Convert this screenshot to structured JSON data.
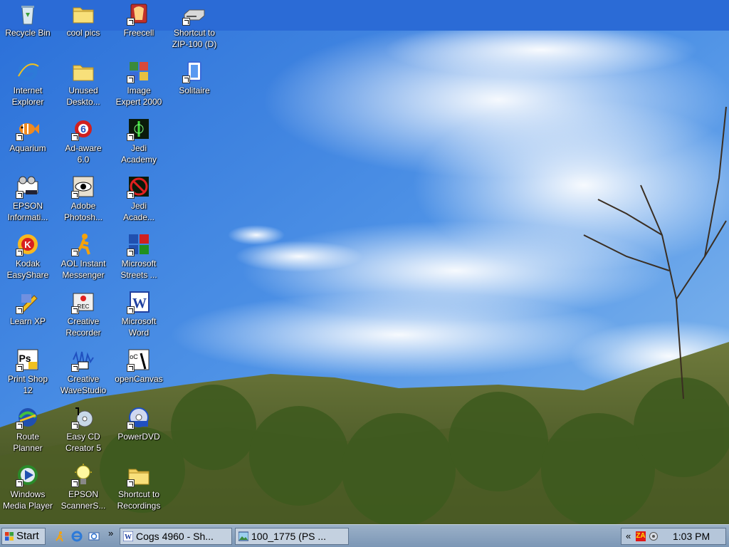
{
  "desktop": {
    "icons": [
      {
        "label": "Recycle Bin",
        "icon": "recycle-bin-icon"
      },
      {
        "label": "cool pics",
        "icon": "folder-icon"
      },
      {
        "label": "Freecell",
        "icon": "freecell-icon"
      },
      {
        "label": "Shortcut to\nZIP-100 (D)",
        "icon": "zip-drive-icon"
      },
      {
        "label": "Internet\nExplorer",
        "icon": "internet-explorer-icon"
      },
      {
        "label": "Unused\nDeskto...",
        "icon": "folder-icon"
      },
      {
        "label": "Image\nExpert 2000",
        "icon": "image-expert-icon"
      },
      {
        "label": "Solitaire",
        "icon": "solitaire-icon"
      },
      {
        "label": "Aquarium",
        "icon": "fish-icon"
      },
      {
        "label": "Ad-aware\n6.0",
        "icon": "ad-aware-icon"
      },
      {
        "label": "Jedi\nAcademy",
        "icon": "jedi-academy-icon"
      },
      {
        "label": "EPSON\nInformati...",
        "icon": "epson-info-icon"
      },
      {
        "label": "Adobe\nPhotosh...",
        "icon": "photoshop-eye-icon"
      },
      {
        "label": "Jedi\nAcade...",
        "icon": "jedi-academy-no-icon"
      },
      {
        "label": "Kodak\nEasyShare",
        "icon": "kodak-icon"
      },
      {
        "label": "AOL Instant\nMessenger",
        "icon": "aim-running-man-icon"
      },
      {
        "label": "Microsoft\nStreets ...",
        "icon": "streets-icon"
      },
      {
        "label": "Learn XP",
        "icon": "learn-xp-icon"
      },
      {
        "label": "Creative\nRecorder",
        "icon": "rec-icon"
      },
      {
        "label": "Microsoft\nWord",
        "icon": "word-icon"
      },
      {
        "label": "Print Shop\n12",
        "icon": "print-shop-icon"
      },
      {
        "label": "Creative\nWaveStudio",
        "icon": "wavestudio-icon"
      },
      {
        "label": "openCanvas",
        "icon": "opencanvas-icon"
      },
      {
        "label": "Route\nPlanner",
        "icon": "route-planner-icon"
      },
      {
        "label": "Easy CD\nCreator 5",
        "icon": "cd-creator-icon"
      },
      {
        "label": "PowerDVD",
        "icon": "powerdvd-icon"
      },
      {
        "label": "Windows\nMedia Player",
        "icon": "media-player-icon"
      },
      {
        "label": "EPSON\nScannerS...",
        "icon": "scanner-bulb-icon"
      },
      {
        "label": "Shortcut to\nRecordings",
        "icon": "folder-icon"
      }
    ]
  },
  "taskbar": {
    "start_label": "Start",
    "quick_launch": [
      "aim-running-man-icon",
      "internet-explorer-icon",
      "outlook-express-icon"
    ],
    "chevron": "»",
    "tasks": [
      {
        "label": "Cogs 4960 - Sh...",
        "icon": "word-icon"
      },
      {
        "label": "100_1775 (PS ...",
        "icon": "image-viewer-icon"
      }
    ],
    "tray": {
      "chevron": "«",
      "za_label": "ZA",
      "clock": "1:03 PM"
    }
  },
  "colors": {
    "top_band": "#2b6bd6",
    "taskbar": "#8aa3c0"
  }
}
